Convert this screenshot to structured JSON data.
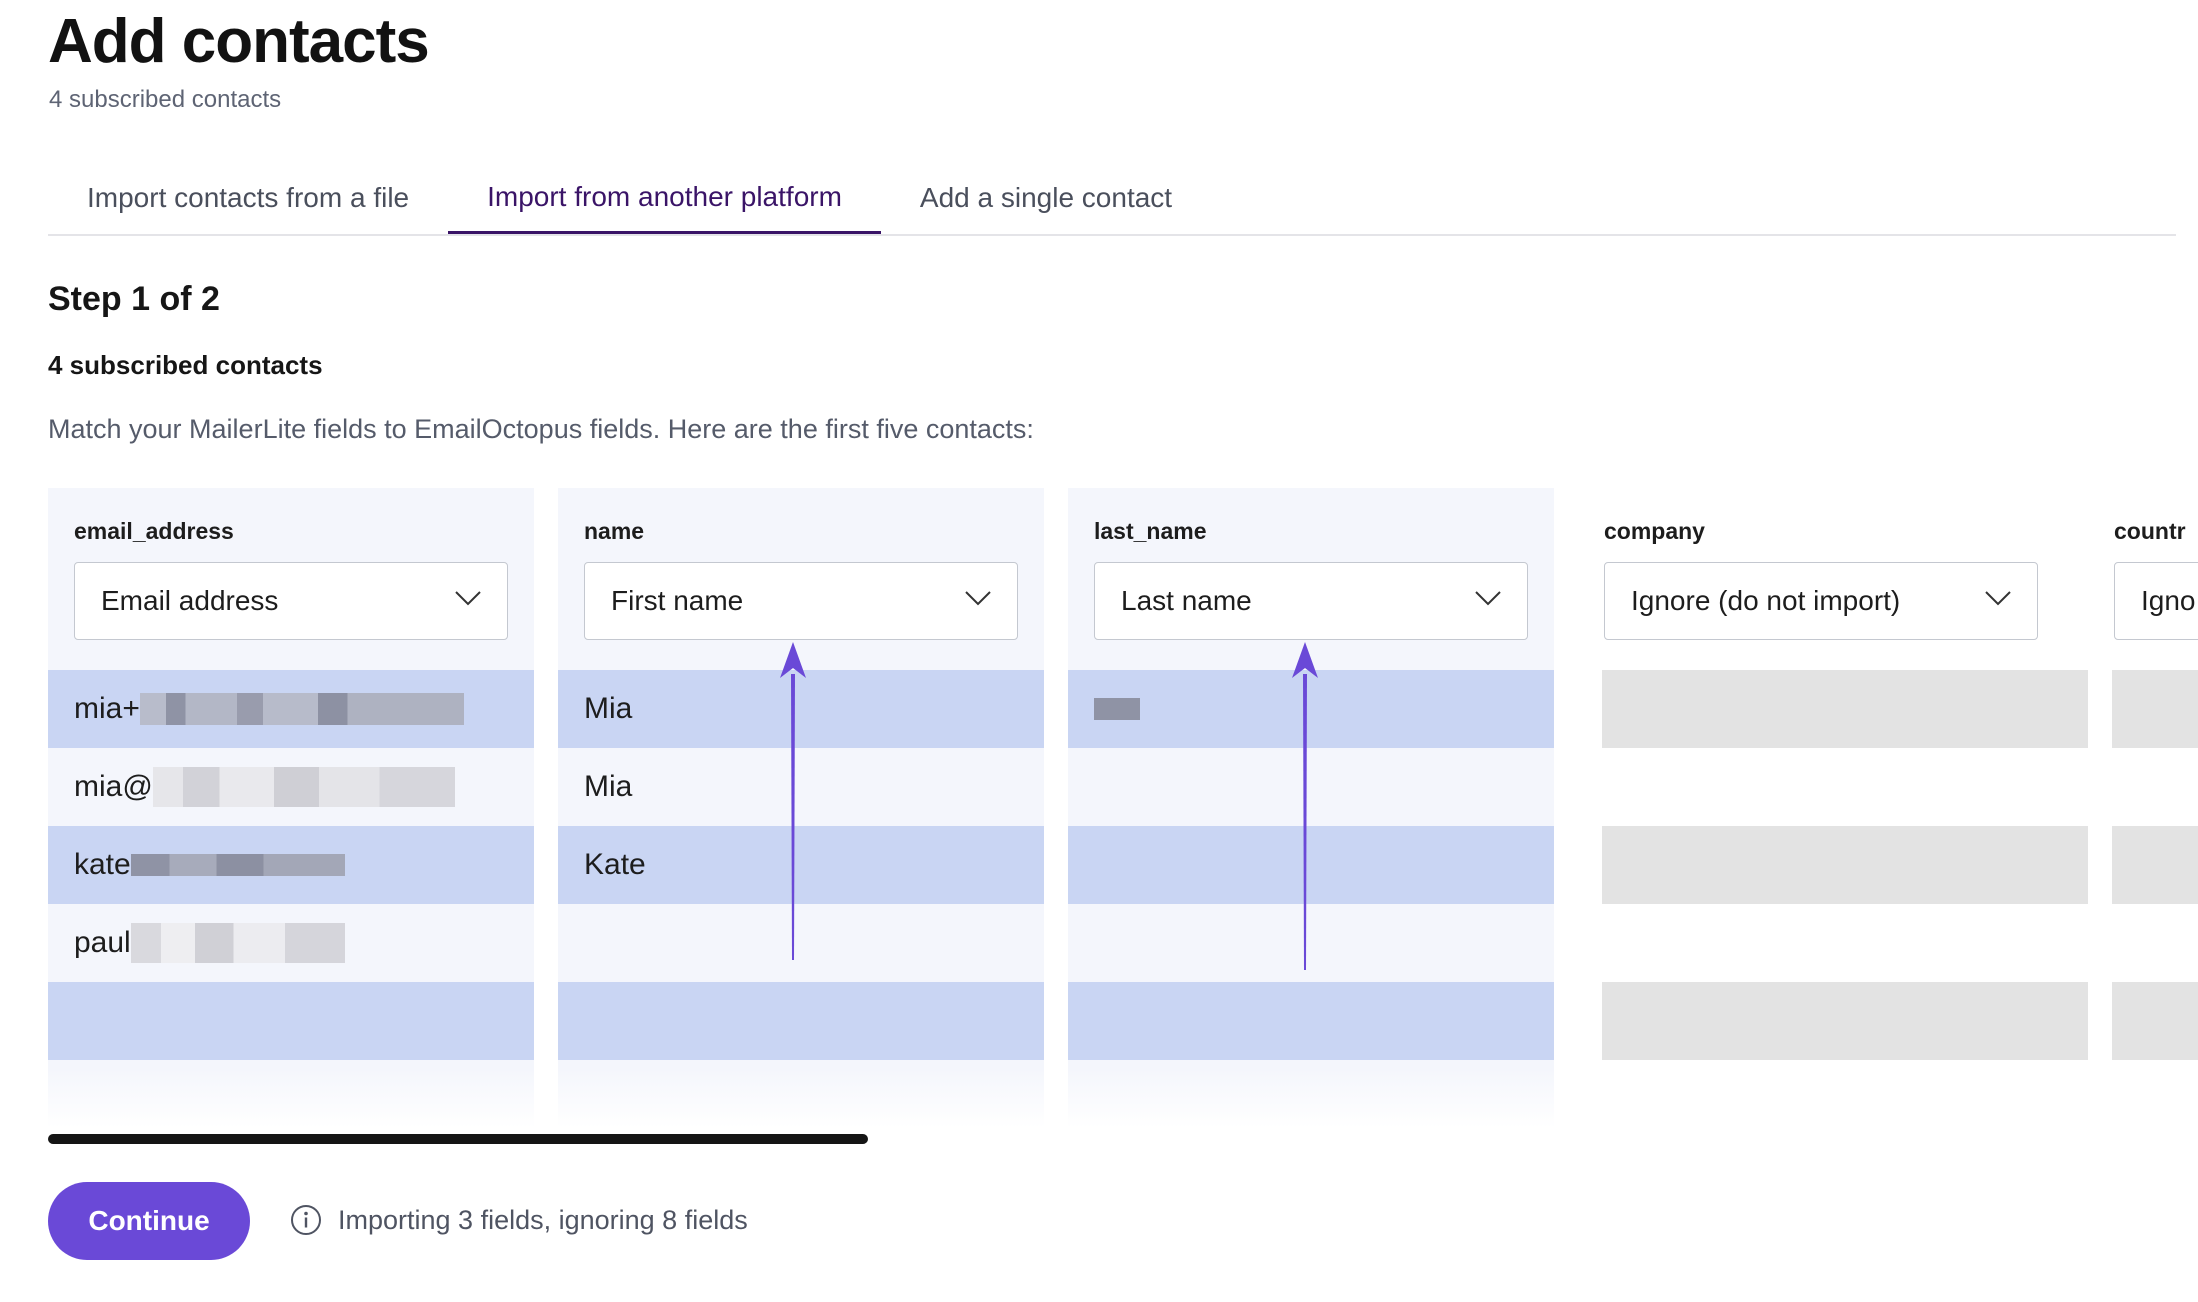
{
  "header": {
    "title": "Add contacts",
    "subtitle": "4 subscribed contacts"
  },
  "tabs": [
    {
      "label": "Import contacts from a file",
      "active": false
    },
    {
      "label": "Import from another platform",
      "active": true
    },
    {
      "label": "Add a single contact",
      "active": false
    }
  ],
  "step": {
    "title": "Step 1 of 2",
    "count": "4 subscribed contacts",
    "instructions": "Match your MailerLite fields to EmailOctopus fields. Here are the first five contacts:"
  },
  "columns": [
    {
      "header": "email_address",
      "mapping": "Email address",
      "cells": [
        "mia+",
        "mia@",
        "kate",
        "paul",
        ""
      ]
    },
    {
      "header": "name",
      "mapping": "First name",
      "cells": [
        "Mia",
        "Mia",
        "Kate",
        "",
        ""
      ]
    },
    {
      "header": "last_name",
      "mapping": "Last name",
      "cells": [
        "",
        "",
        "",
        "",
        ""
      ]
    },
    {
      "header": "company",
      "mapping": "Ignore (do not import)",
      "cells": [
        "",
        "",
        "",
        "",
        ""
      ]
    },
    {
      "header": "countr",
      "mapping": "Igno",
      "cells": [
        "",
        "",
        "",
        "",
        ""
      ]
    }
  ],
  "footer": {
    "continue_label": "Continue",
    "info_text": "Importing 3 fields, ignoring 8 fields",
    "info_icon": "info-icon"
  },
  "colors": {
    "accent": "#6a49d7",
    "active_tab": "#3a1467",
    "mapped_row": "#c9d5f3",
    "ignored_row": "#e3e3e3"
  }
}
